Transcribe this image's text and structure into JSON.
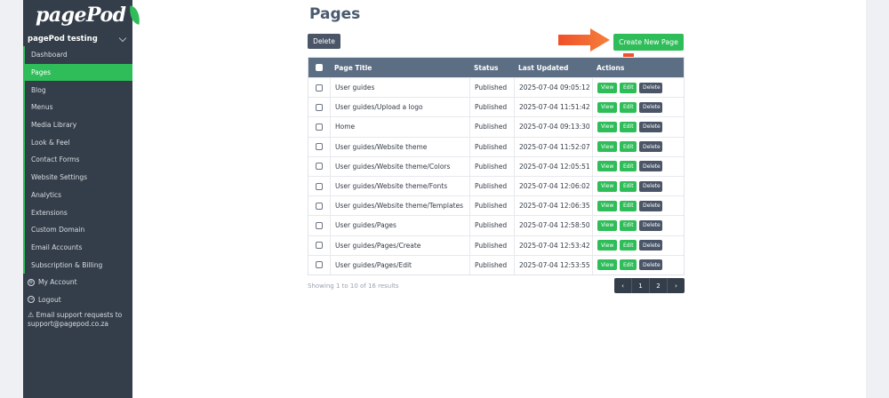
{
  "app": {
    "logo_text": "pagePod",
    "site_name": "pagePod testing"
  },
  "sidebar": {
    "items": [
      {
        "label": "Dashboard",
        "active": false
      },
      {
        "label": "Pages",
        "active": true
      },
      {
        "label": "Blog",
        "active": false
      },
      {
        "label": "Menus",
        "active": false
      },
      {
        "label": "Media Library",
        "active": false
      },
      {
        "label": "Look & Feel",
        "active": false
      },
      {
        "label": "Contact Forms",
        "active": false
      },
      {
        "label": "Website Settings",
        "active": false
      },
      {
        "label": "Analytics",
        "active": false
      },
      {
        "label": "Extensions",
        "active": false
      },
      {
        "label": "Custom Domain",
        "active": false
      },
      {
        "label": "Email Accounts",
        "active": false
      },
      {
        "label": "Subscription & Billing",
        "active": false
      }
    ],
    "my_account": "My Account",
    "logout": "Logout",
    "support": "Email support requests to support@pagepod.co.za"
  },
  "page": {
    "title": "Pages",
    "delete_label": "Delete",
    "create_label": "Create New Page"
  },
  "table": {
    "headers": {
      "title": "Page Title",
      "status": "Status",
      "updated": "Last Updated",
      "actions": "Actions"
    },
    "action_labels": {
      "view": "View",
      "edit": "Edit",
      "delete": "Delete"
    },
    "rows": [
      {
        "title": "User guides",
        "status": "Published",
        "updated": "2025-07-04 09:05:12"
      },
      {
        "title": "User guides/Upload a logo",
        "status": "Published",
        "updated": "2025-07-04 11:51:42"
      },
      {
        "title": "Home",
        "status": "Published",
        "updated": "2025-07-04 09:13:30"
      },
      {
        "title": "User guides/Website theme",
        "status": "Published",
        "updated": "2025-07-04 11:52:07"
      },
      {
        "title": "User guides/Website theme/Colors",
        "status": "Published",
        "updated": "2025-07-04 12:05:51"
      },
      {
        "title": "User guides/Website theme/Fonts",
        "status": "Published",
        "updated": "2025-07-04 12:06:02"
      },
      {
        "title": "User guides/Website theme/Templates",
        "status": "Published",
        "updated": "2025-07-04 12:06:35"
      },
      {
        "title": "User guides/Pages",
        "status": "Published",
        "updated": "2025-07-04 12:58:50"
      },
      {
        "title": "User guides/Pages/Create",
        "status": "Published",
        "updated": "2025-07-04 12:53:42"
      },
      {
        "title": "User guides/Pages/Edit",
        "status": "Published",
        "updated": "2025-07-04 12:53:55"
      }
    ]
  },
  "pagination": {
    "showing": "Showing 1 to 10 of 16 results",
    "prev": "‹",
    "page1": "1",
    "page2": "2",
    "next": "›"
  },
  "colors": {
    "accent": "#2fbd59",
    "sidebar": "#343e4a",
    "header": "#5c6e84",
    "arrow": "#f0502a"
  }
}
